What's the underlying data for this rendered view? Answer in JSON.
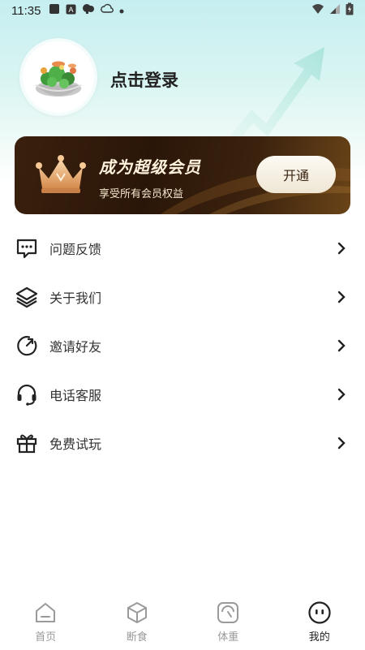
{
  "status_bar": {
    "time": "11:35",
    "icons": [
      "notification-square-icon",
      "text-a-icon",
      "cloud-chat-icon",
      "cloud-icon",
      "dot-icon"
    ],
    "right_icons": [
      "wifi-icon",
      "signal-icon",
      "battery-charging-icon"
    ]
  },
  "profile": {
    "avatar_icon": "salad-bowl-icon",
    "login_label": "点击登录"
  },
  "vip": {
    "title": "成为超级会员",
    "subtitle": "享受所有会员权益",
    "button_label": "开通",
    "icon": "crown-icon"
  },
  "menu": [
    {
      "label": "问题反馈",
      "icon": "feedback-chat-icon"
    },
    {
      "label": "关于我们",
      "icon": "layers-icon"
    },
    {
      "label": "邀请好友",
      "icon": "refresh-arrow-icon"
    },
    {
      "label": "电话客服",
      "icon": "headset-icon"
    },
    {
      "label": "免费试玩",
      "icon": "gift-icon"
    }
  ],
  "nav": [
    {
      "label": "首页",
      "icon": "home-icon",
      "active": false
    },
    {
      "label": "断食",
      "icon": "cube-icon",
      "active": false
    },
    {
      "label": "体重",
      "icon": "scale-icon",
      "active": false
    },
    {
      "label": "我的",
      "icon": "smiley-face-icon",
      "active": true
    }
  ],
  "colors": {
    "header_gradient_top": "#c6eef0",
    "vip_card_dark": "#2a1608",
    "vip_text": "#fff3dc",
    "active_nav": "#222222",
    "inactive_nav": "#999999"
  }
}
